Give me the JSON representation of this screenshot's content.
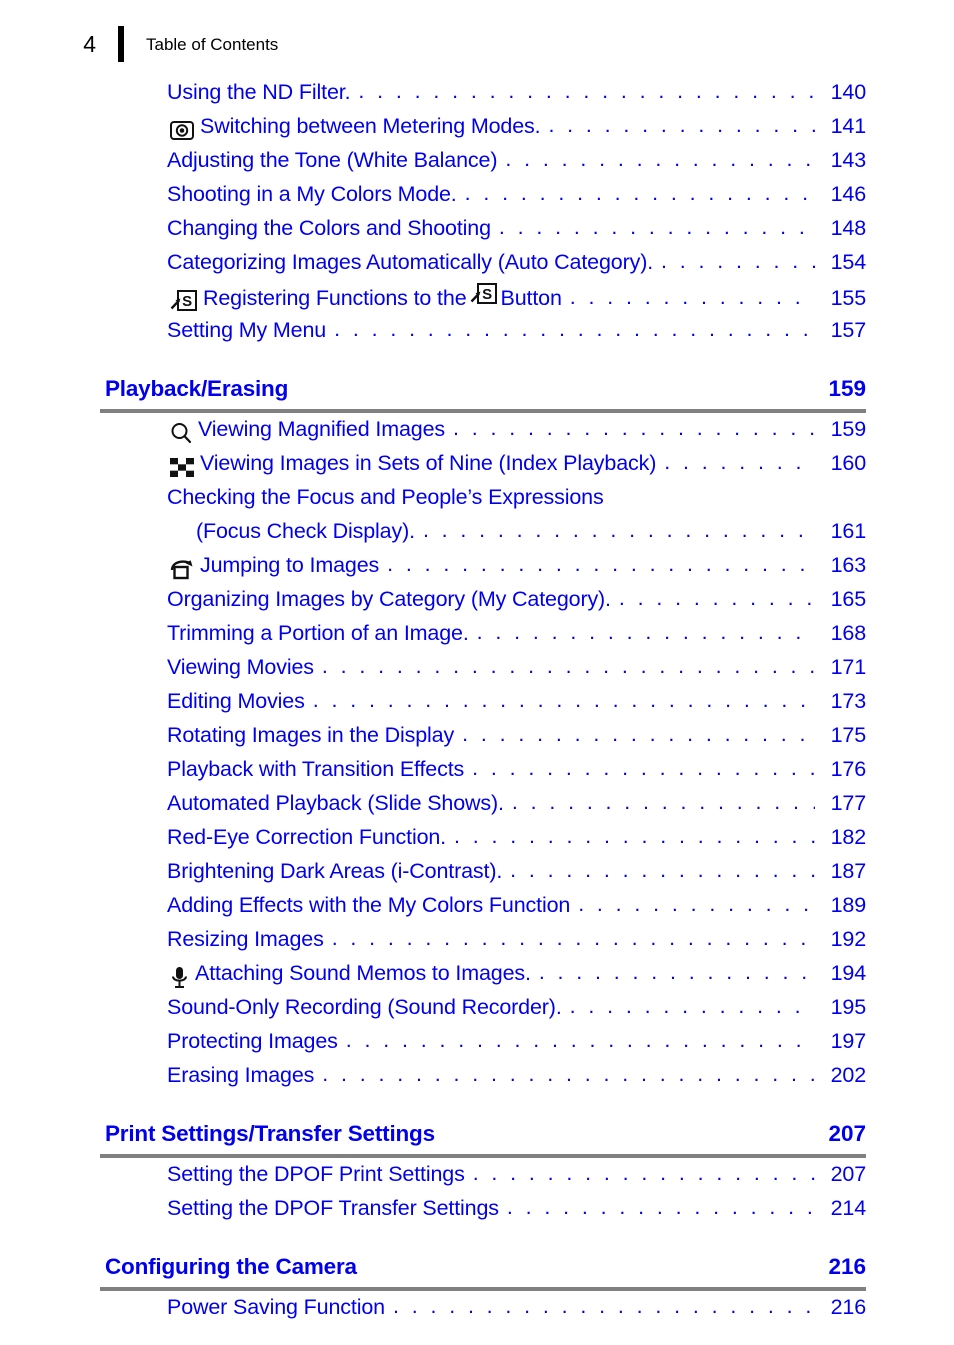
{
  "header": {
    "page_number": "4",
    "title": "Table of Contents"
  },
  "colors": {
    "link_blue": "#0000ee",
    "heading_blue": "#0000ee",
    "rule_gray": "#808080",
    "header_black": "#000000"
  },
  "leader_dots": ". . . . . . . . . . . . . . . . . . . . . . . . . . . . . . . . . . . . . . . . . . . . . . . . . . . . . . . . . . . . . . . .",
  "top_entries": [
    {
      "icon": null,
      "label": "Using the ND Filter.",
      "page": "140"
    },
    {
      "icon": "metering-mode-icon",
      "label": "Switching between Metering Modes.",
      "page": "141"
    },
    {
      "icon": null,
      "label": "Adjusting the Tone (White Balance)",
      "page": "143"
    },
    {
      "icon": null,
      "label": "Shooting in a My Colors Mode.",
      "page": "146"
    },
    {
      "icon": null,
      "label": "Changing the Colors and Shooting",
      "page": "148"
    },
    {
      "icon": null,
      "label": "Categorizing Images Automatically (Auto Category).",
      "page": "154"
    },
    {
      "icon": "shortcut-button-icon",
      "label_before": "Registering Functions to the",
      "label_after": "Button",
      "page": "155"
    },
    {
      "icon": null,
      "label": "Setting My Menu",
      "page": "157"
    }
  ],
  "sections": [
    {
      "title": "Playback/Erasing",
      "page": "159",
      "entries": [
        {
          "icon": "magnifier-icon",
          "label": "Viewing Magnified Images",
          "page": "159"
        },
        {
          "icon": "index-playback-icon",
          "label": "Viewing Images in Sets of Nine (Index Playback)",
          "page": "160"
        },
        {
          "icon": null,
          "label": "Checking the Focus and People’s Expressions",
          "page": "",
          "wrapped": true
        },
        {
          "icon": null,
          "label": "(Focus Check Display).",
          "page": "161",
          "continuation": true
        },
        {
          "icon": "jump-icon",
          "label": "Jumping to Images",
          "page": "163"
        },
        {
          "icon": null,
          "label": "Organizing Images by Category (My Category).",
          "page": "165"
        },
        {
          "icon": null,
          "label": "Trimming a Portion of an Image.",
          "page": "168"
        },
        {
          "icon": null,
          "label": "Viewing Movies",
          "page": "171"
        },
        {
          "icon": null,
          "label": "Editing Movies",
          "page": "173"
        },
        {
          "icon": null,
          "label": "Rotating Images in the Display",
          "page": "175"
        },
        {
          "icon": null,
          "label": "Playback with Transition Effects",
          "page": "176"
        },
        {
          "icon": null,
          "label": "Automated Playback (Slide Shows).",
          "page": "177"
        },
        {
          "icon": null,
          "label": "Red-Eye Correction Function.",
          "page": "182"
        },
        {
          "icon": null,
          "label": "Brightening Dark Areas (i-Contrast).",
          "page": "187"
        },
        {
          "icon": null,
          "label": "Adding Effects with the My Colors Function",
          "page": "189"
        },
        {
          "icon": null,
          "label": "Resizing Images",
          "page": "192"
        },
        {
          "icon": "microphone-icon",
          "label": "Attaching Sound Memos to Images.",
          "page": "194"
        },
        {
          "icon": null,
          "label": "Sound-Only Recording (Sound Recorder).",
          "page": "195"
        },
        {
          "icon": null,
          "label": "Protecting Images",
          "page": "197"
        },
        {
          "icon": null,
          "label": "Erasing Images",
          "page": "202"
        }
      ]
    },
    {
      "title": "Print Settings/Transfer Settings",
      "page": "207",
      "entries": [
        {
          "icon": null,
          "label": "Setting the DPOF Print Settings",
          "page": "207"
        },
        {
          "icon": null,
          "label": "Setting the DPOF Transfer Settings",
          "page": "214"
        }
      ]
    },
    {
      "title": "Configuring the Camera",
      "page": "216",
      "entries": [
        {
          "icon": null,
          "label": "Power Saving Function",
          "page": "216"
        }
      ]
    }
  ]
}
